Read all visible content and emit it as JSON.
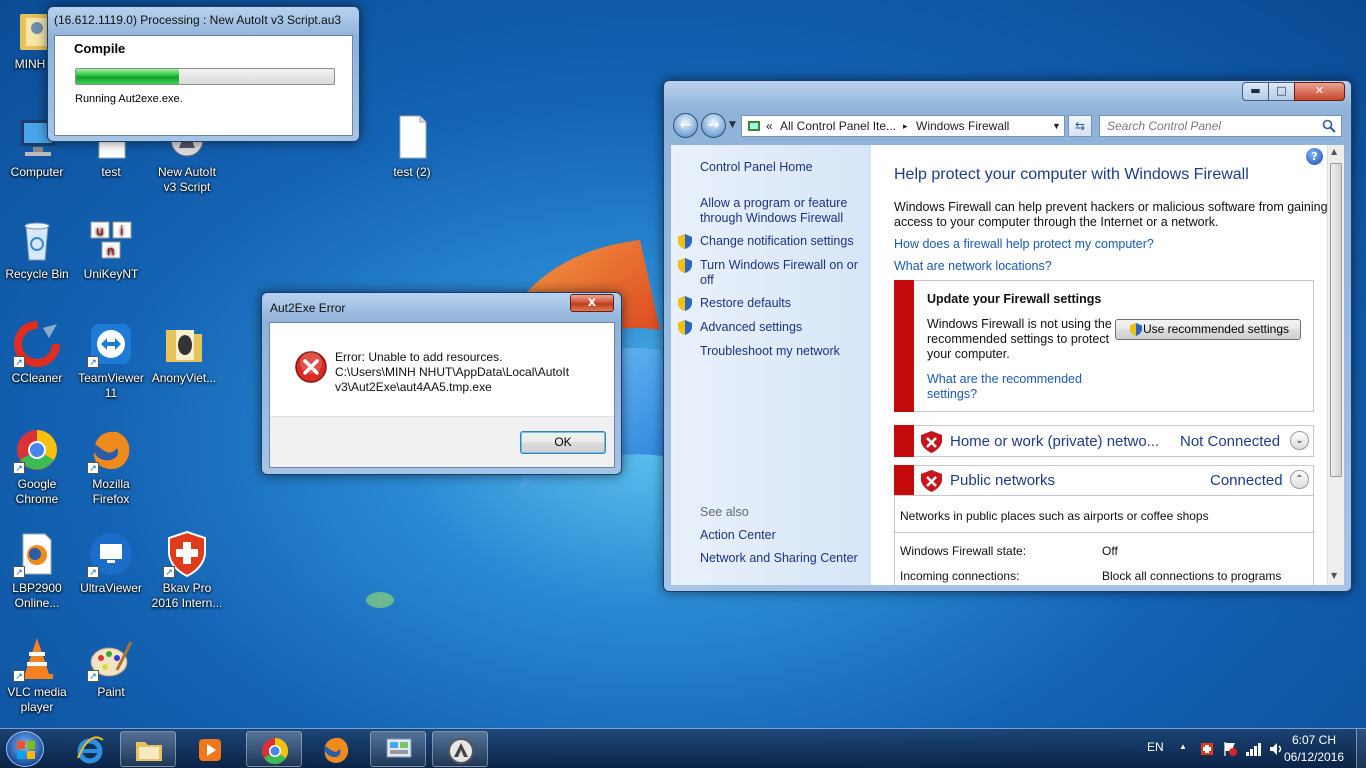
{
  "desktop": {
    "icons": [
      {
        "label": "MINH N",
        "icon": "user-folder"
      },
      {
        "label": "Computer",
        "icon": "computer"
      },
      {
        "label": "test",
        "icon": "document"
      },
      {
        "label": "New AutoIt v3 Script",
        "icon": "autoit-script"
      },
      {
        "label": "test (2)",
        "icon": "document"
      },
      {
        "label": "Recycle Bin",
        "icon": "recycle-bin"
      },
      {
        "label": "UniKeyNT",
        "icon": "unikey"
      },
      {
        "label": "CCleaner",
        "icon": "ccleaner"
      },
      {
        "label": "TeamViewer 11",
        "icon": "teamviewer"
      },
      {
        "label": "AnonyViet...",
        "icon": "folder"
      },
      {
        "label": "Google Chrome",
        "icon": "chrome"
      },
      {
        "label": "Mozilla Firefox",
        "icon": "firefox"
      },
      {
        "label": "LBP2900 Online...",
        "icon": "html-file"
      },
      {
        "label": "UltraViewer",
        "icon": "ultraviewer"
      },
      {
        "label": "Bkav Pro 2016 Intern...",
        "icon": "bkav"
      },
      {
        "label": "VLC media player",
        "icon": "vlc"
      },
      {
        "label": "Paint",
        "icon": "paint"
      }
    ],
    "unikey_letters": [
      "u",
      "i",
      "n"
    ]
  },
  "progress_window": {
    "title": "(16.612.1119.0) Processing : New AutoIt v3 Script.au3",
    "heading": "Compile",
    "status": "Running Aut2exe.exe.",
    "progress": 0.4
  },
  "error_dialog": {
    "title": "Aut2Exe Error",
    "close_label": "x",
    "line1": "Error: Unable to add resources.",
    "line2": "C:\\Users\\MINH NHUT\\AppData\\Local\\AutoIt",
    "line3": "v3\\Aut2Exe\\aut4AA5.tmp.exe",
    "ok_label": "OK",
    "icon": "error-icon"
  },
  "firewall_window": {
    "caption_buttons": {
      "minimize": "▬",
      "maximize": "□",
      "close": "✕"
    },
    "address": {
      "prefix": "«",
      "crumb1": "All Control Panel Ite...",
      "separator": "▸",
      "crumb2": "Windows Firewall"
    },
    "search_placeholder": "Search Control Panel",
    "help_label": "?",
    "left": {
      "home": "Control Panel Home",
      "allow_1": "Allow a program or feature",
      "allow_2": "through Windows Firewall",
      "change_notif": "Change notification settings",
      "turn_1": "Turn Windows Firewall on or",
      "turn_2": "off",
      "restore": "Restore defaults",
      "advanced": "Advanced settings",
      "troubleshoot": "Troubleshoot my network",
      "see_also": "See also",
      "action_center": "Action Center",
      "network_sharing": "Network and Sharing Center"
    },
    "main": {
      "heading": "Help protect your computer with Windows Firewall",
      "intro_1": "Windows Firewall can help prevent hackers or malicious software from gaining",
      "intro_2": "access to your computer through the Internet or a network.",
      "link_how": "How does a firewall help protect my computer?",
      "link_locations": "What are network locations?",
      "update_title": "Update your Firewall settings",
      "update_1": "Windows Firewall is not using the",
      "update_2": "recommended settings to protect",
      "update_3": "your computer.",
      "recommended_btn": "Use recommended settings",
      "rec_link_1": "What are the recommended",
      "rec_link_2": "settings?",
      "home_network": "Home or work (private) netwo...",
      "home_status": "Not Connected",
      "public_network": "Public networks",
      "public_status": "Connected",
      "public_desc": "Networks in public places such as airports or coffee shops",
      "state_label": "Windows Firewall state:",
      "state_value": "Off",
      "incoming_label": "Incoming connections:",
      "incoming_value": "Block all connections to programs"
    }
  },
  "taskbar": {
    "items": [
      "start",
      "internet-explorer",
      "windows-explorer",
      "media-player",
      "chrome",
      "firefox",
      "control-panel",
      "autoit"
    ],
    "lang": "EN",
    "time": "6:07 CH",
    "date": "06/12/2016",
    "tray_arrow": "▲"
  }
}
